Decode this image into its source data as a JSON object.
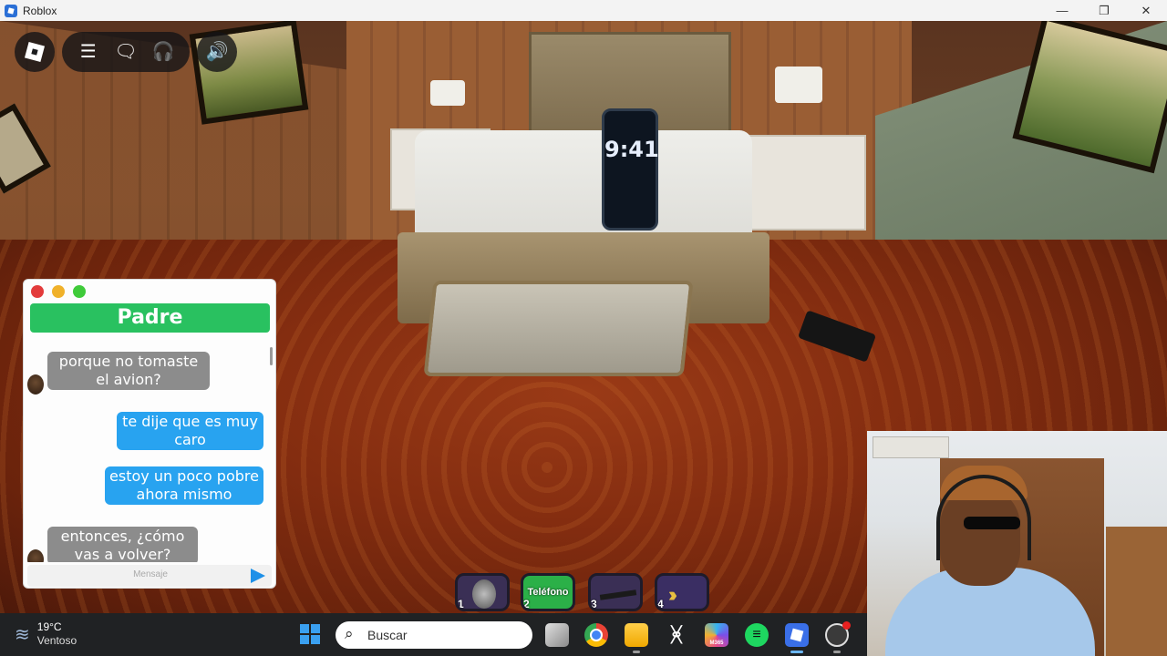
{
  "window": {
    "title": "Roblox",
    "minimize_glyph": "—",
    "maximize_glyph": "❐",
    "close_glyph": "✕"
  },
  "scene": {
    "phone_time": "9:41"
  },
  "roblox_controls": {
    "logo_icon": "roblox-logo-icon",
    "menu_icon": "hamburger-menu-icon",
    "chat_icon": "chat-icon",
    "emote_icon": "headset-icon",
    "volume_icon": "speaker-icon"
  },
  "chat": {
    "contact_name": "Padre",
    "messages": [
      {
        "direction": "in",
        "text": "porque no tomaste el avion?"
      },
      {
        "direction": "out",
        "text": "te dije que es muy caro"
      },
      {
        "direction": "out",
        "text": "estoy un poco pobre ahora mismo"
      },
      {
        "direction": "in",
        "text": "entonces, ¿cómo vas a volver?"
      }
    ],
    "input_placeholder": "Mensaje"
  },
  "hotbar": {
    "slots": [
      {
        "number": "1",
        "label": ""
      },
      {
        "number": "2",
        "label": "Teléfono"
      },
      {
        "number": "3",
        "label": ""
      },
      {
        "number": "4",
        "label": ""
      }
    ]
  },
  "taskbar": {
    "weather": {
      "temperature": "19°C",
      "condition": "Ventoso"
    },
    "search_placeholder": "Buscar",
    "apps": [
      "start-icon",
      "task-view-icon",
      "chrome-icon",
      "file-explorer-icon",
      "capcut-icon",
      "microsoft-365-icon",
      "spotify-icon",
      "roblox-icon",
      "obs-icon"
    ],
    "m365_label": "M365"
  }
}
